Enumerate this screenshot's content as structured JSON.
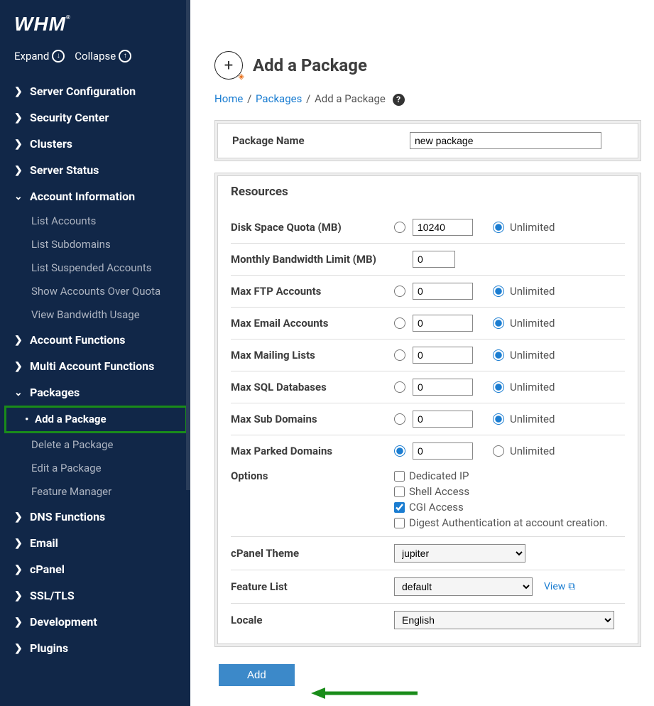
{
  "logo": "WHM",
  "expand_label": "Expand",
  "collapse_label": "Collapse",
  "nav": {
    "server_configuration": "Server Configuration",
    "security_center": "Security Center",
    "clusters": "Clusters",
    "server_status": "Server Status",
    "account_information": "Account Information",
    "account_info_items": {
      "list_accounts": "List Accounts",
      "list_subdomains": "List Subdomains",
      "list_suspended": "List Suspended Accounts",
      "show_over_quota": "Show Accounts Over Quota",
      "view_bandwidth": "View Bandwidth Usage"
    },
    "account_functions": "Account Functions",
    "multi_account_functions": "Multi Account Functions",
    "packages": "Packages",
    "packages_items": {
      "add_package": "Add a Package",
      "delete_package": "Delete a Package",
      "edit_package": "Edit a Package",
      "feature_manager": "Feature Manager"
    },
    "dns_functions": "DNS Functions",
    "email": "Email",
    "cpanel": "cPanel",
    "ssl_tls": "SSL/TLS",
    "development": "Development",
    "plugins": "Plugins"
  },
  "page_title": "Add a Package",
  "breadcrumb": {
    "home": "Home",
    "packages": "Packages",
    "current": "Add a Package"
  },
  "form": {
    "package_name_label": "Package Name",
    "package_name_value": "new package",
    "resources_title": "Resources",
    "unlimited": "Unlimited",
    "fields": {
      "disk_quota": {
        "label": "Disk Space Quota (MB)",
        "value": "10240"
      },
      "bandwidth": {
        "label": "Monthly Bandwidth Limit (MB)",
        "value": "0"
      },
      "max_ftp": {
        "label": "Max FTP Accounts",
        "value": "0"
      },
      "max_email": {
        "label": "Max Email Accounts",
        "value": "0"
      },
      "max_mailing": {
        "label": "Max Mailing Lists",
        "value": "0"
      },
      "max_sql": {
        "label": "Max SQL Databases",
        "value": "0"
      },
      "max_sub": {
        "label": "Max Sub Domains",
        "value": "0"
      },
      "max_parked": {
        "label": "Max Parked Domains",
        "value": "0"
      }
    },
    "options_label": "Options",
    "options": {
      "dedicated_ip": "Dedicated IP",
      "shell_access": "Shell Access",
      "cgi_access": "CGI Access",
      "digest_auth": "Digest Authentication at account creation."
    },
    "cpanel_theme_label": "cPanel Theme",
    "cpanel_theme_value": "jupiter",
    "feature_list_label": "Feature List",
    "feature_list_value": "default",
    "view_label": "View",
    "locale_label": "Locale",
    "locale_value": "English",
    "add_button": "Add"
  }
}
